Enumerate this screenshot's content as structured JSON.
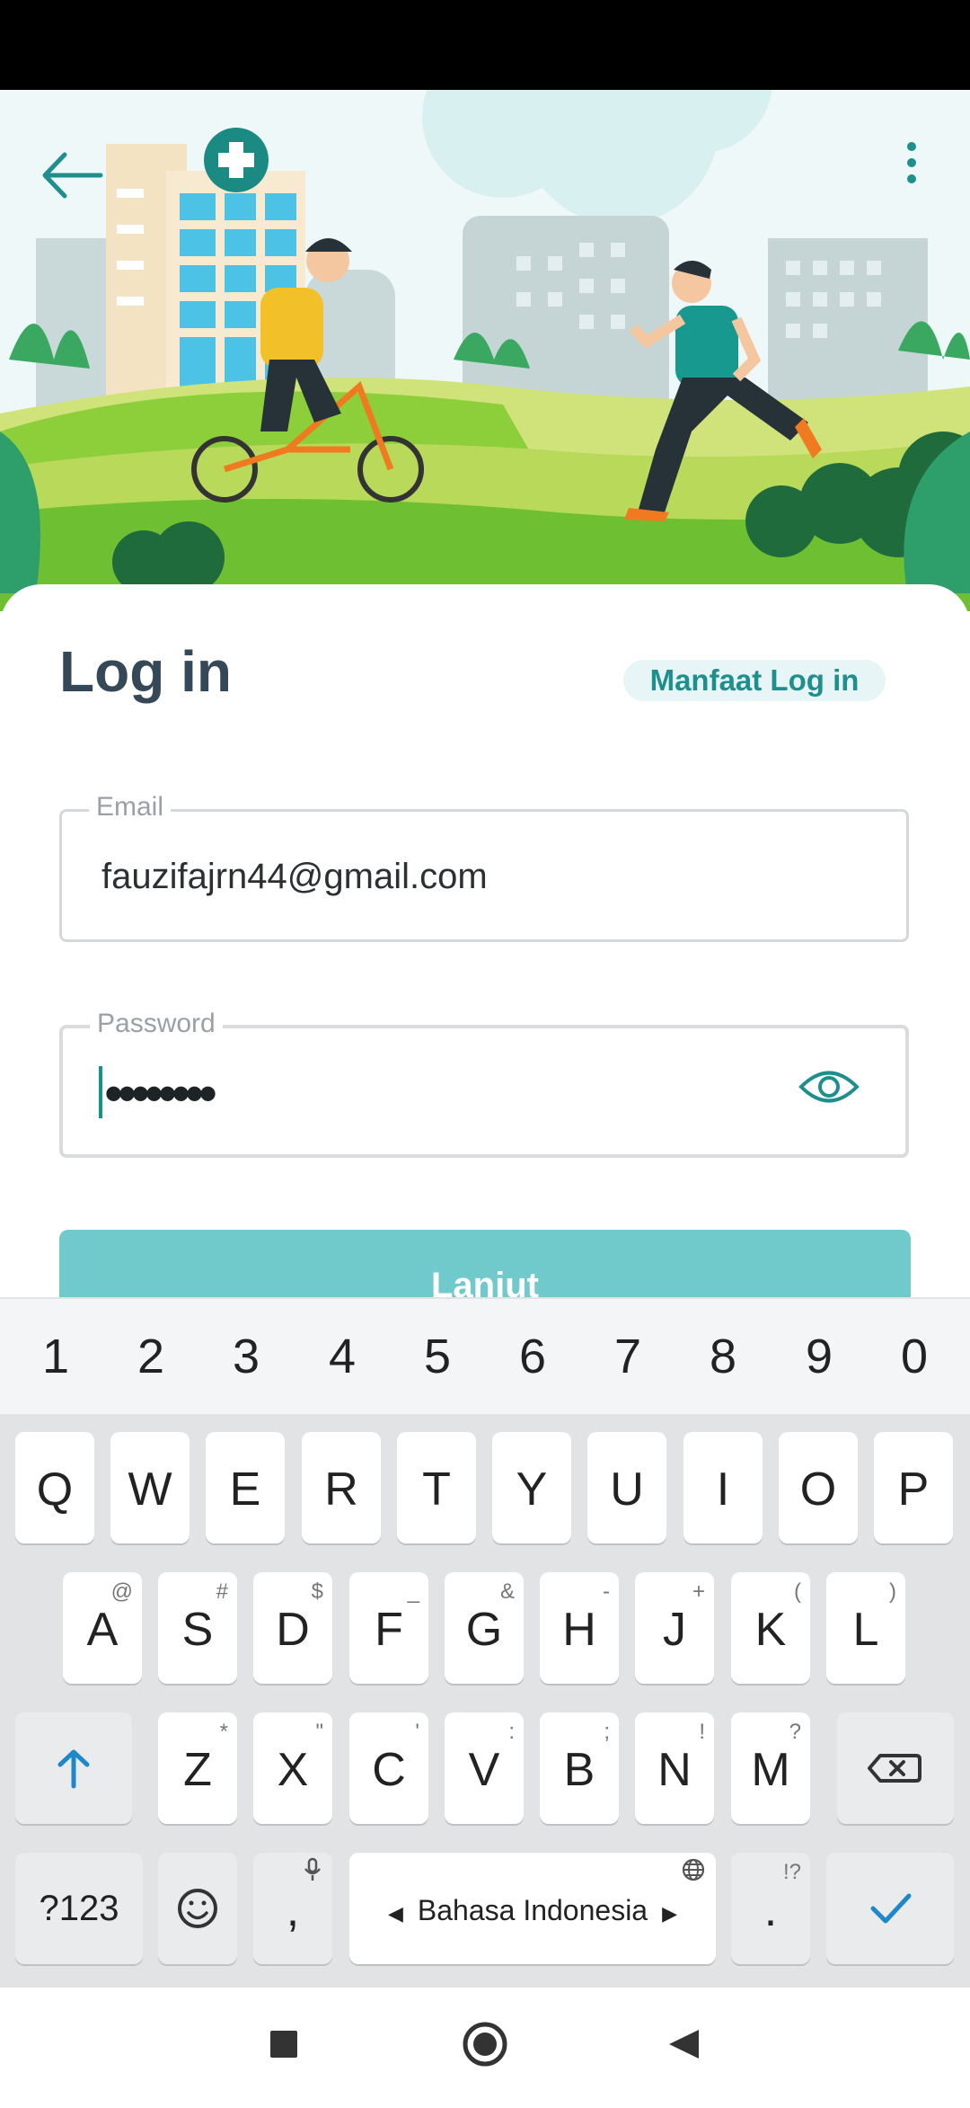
{
  "login": {
    "title": "Log in",
    "benefit_link": "Manfaat Log in",
    "email_label": "Email",
    "email_value": "fauzifajrn44@gmail.com",
    "password_label": "Password",
    "password_value": "••••••••",
    "submit_label": "Lanjut"
  },
  "keyboard": {
    "number_row": [
      "1",
      "2",
      "3",
      "4",
      "5",
      "6",
      "7",
      "8",
      "9",
      "0"
    ],
    "row1": [
      "Q",
      "W",
      "E",
      "R",
      "T",
      "Y",
      "U",
      "I",
      "O",
      "P"
    ],
    "row2": [
      {
        "k": "A",
        "s": "@"
      },
      {
        "k": "S",
        "s": "#"
      },
      {
        "k": "D",
        "s": "$"
      },
      {
        "k": "F",
        "s": "_"
      },
      {
        "k": "G",
        "s": "&"
      },
      {
        "k": "H",
        "s": "-"
      },
      {
        "k": "J",
        "s": "+"
      },
      {
        "k": "K",
        "s": "("
      },
      {
        "k": "L",
        "s": ")"
      }
    ],
    "row3": [
      {
        "k": "Z",
        "s": "*"
      },
      {
        "k": "X",
        "s": "\""
      },
      {
        "k": "C",
        "s": "'"
      },
      {
        "k": "V",
        "s": ":"
      },
      {
        "k": "B",
        "s": ";"
      },
      {
        "k": "N",
        "s": "!"
      },
      {
        "k": "M",
        "s": "?"
      }
    ],
    "symbols_key": "?123",
    "comma_key": ",",
    "space_label": "Bahasa Indonesia",
    "period_key": ".",
    "period_sub": "!?"
  },
  "icons": {
    "back": "arrow-left-icon",
    "more": "more-vertical-icon",
    "eye": "eye-icon",
    "shift": "shift-icon",
    "backspace": "backspace-icon",
    "emoji": "emoji-icon",
    "mic": "mic-icon",
    "globe": "globe-icon",
    "enter": "check-icon"
  },
  "colors": {
    "accent": "#1e8f8d",
    "button": "#70cacc",
    "title": "#344857"
  }
}
